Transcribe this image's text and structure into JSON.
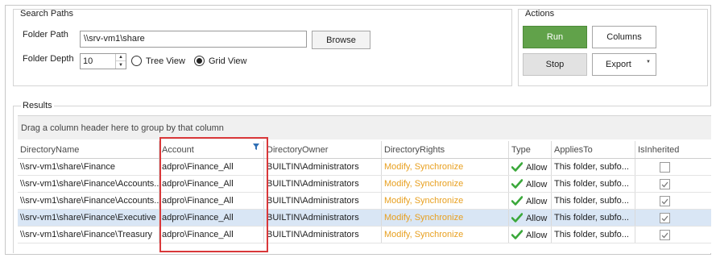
{
  "search_paths": {
    "title": "Search Paths",
    "folder_path_label": "Folder Path",
    "folder_path_value": "\\\\srv-vm1\\share",
    "browse_label": "Browse",
    "folder_depth_label": "Folder Depth",
    "folder_depth_value": "10",
    "tree_view_label": "Tree View",
    "grid_view_label": "Grid View",
    "selected_view": "Grid View"
  },
  "actions": {
    "title": "Actions",
    "run_label": "Run",
    "columns_label": "Columns",
    "stop_label": "Stop",
    "export_label": "Export",
    "run_color": "#61a24a"
  },
  "results": {
    "title": "Results",
    "group_hint": "Drag a column header here to group by that column",
    "columns": [
      "DirectoryName",
      "Account",
      "DirectoryOwner",
      "DirectoryRights",
      "Type",
      "AppliesTo",
      "IsInherited"
    ],
    "rows": [
      {
        "directory": "\\\\srv-vm1\\share\\Finance",
        "account": "adpro\\Finance_All",
        "owner": "BUILTIN\\Administrators",
        "rights": "Modify, Synchronize",
        "type": "Allow",
        "applies": "This folder, subfo...",
        "inherited": false
      },
      {
        "directory": "\\\\srv-vm1\\share\\Finance\\Accounts...",
        "account": "adpro\\Finance_All",
        "owner": "BUILTIN\\Administrators",
        "rights": "Modify, Synchronize",
        "type": "Allow",
        "applies": "This folder, subfo...",
        "inherited": true
      },
      {
        "directory": "\\\\srv-vm1\\share\\Finance\\Accounts...",
        "account": "adpro\\Finance_All",
        "owner": "BUILTIN\\Administrators",
        "rights": "Modify, Synchronize",
        "type": "Allow",
        "applies": "This folder, subfo...",
        "inherited": true
      },
      {
        "directory": "\\\\srv-vm1\\share\\Finance\\Executive",
        "account": "adpro\\Finance_All",
        "owner": "BUILTIN\\Administrators",
        "rights": "Modify, Synchronize",
        "type": "Allow",
        "applies": "This folder, subfo...",
        "inherited": true
      },
      {
        "directory": "\\\\srv-vm1\\share\\Finance\\Treasury",
        "account": "adpro\\Finance_All",
        "owner": "BUILTIN\\Administrators",
        "rights": "Modify, Synchronize",
        "type": "Allow",
        "applies": "This folder, subfo...",
        "inherited": true
      }
    ],
    "selected_row": 3,
    "rights_color": "#e8a020",
    "allow_icon": "green-check-icon",
    "filter_icon": "filter-icon",
    "highlight_color": "#d9383a"
  }
}
